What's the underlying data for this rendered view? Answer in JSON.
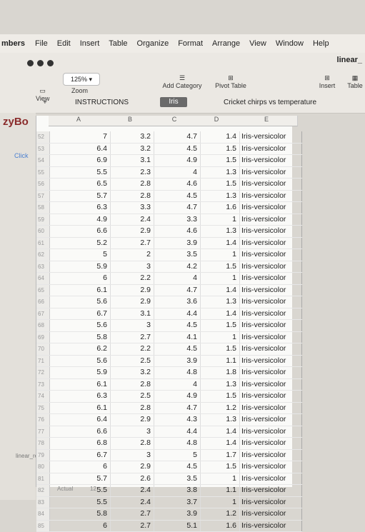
{
  "menubar": {
    "app": "mbers",
    "items": [
      "File",
      "Edit",
      "Insert",
      "Table",
      "Organize",
      "Format",
      "Arrange",
      "View",
      "Window",
      "Help"
    ]
  },
  "toolbar": {
    "doc_title": "linear_",
    "view_label": "View",
    "zoom_label": "Zoom",
    "zoom_value": "125%",
    "add_category": "Add Category",
    "pivot_table": "Pivot Table",
    "insert_label": "Insert",
    "table_label": "Table"
  },
  "tabs": {
    "instructions": "INSTRUCTIONS",
    "iris": "Iris",
    "cricket": "Cricket chirps vs temperature"
  },
  "sidebar": {
    "brand": "zyBo",
    "click": "Click",
    "bottom": "linear_reg"
  },
  "sheet": {
    "col_headers": [
      "A",
      "B",
      "C",
      "D",
      "E"
    ],
    "rows": [
      {
        "rn": "52",
        "a": "7",
        "b": "3.2",
        "c": "4.7",
        "d": "1.4",
        "e": "Iris-versicolor"
      },
      {
        "rn": "53",
        "a": "6.4",
        "b": "3.2",
        "c": "4.5",
        "d": "1.5",
        "e": "Iris-versicolor"
      },
      {
        "rn": "54",
        "a": "6.9",
        "b": "3.1",
        "c": "4.9",
        "d": "1.5",
        "e": "Iris-versicolor"
      },
      {
        "rn": "55",
        "a": "5.5",
        "b": "2.3",
        "c": "4",
        "d": "1.3",
        "e": "Iris-versicolor"
      },
      {
        "rn": "56",
        "a": "6.5",
        "b": "2.8",
        "c": "4.6",
        "d": "1.5",
        "e": "Iris-versicolor"
      },
      {
        "rn": "57",
        "a": "5.7",
        "b": "2.8",
        "c": "4.5",
        "d": "1.3",
        "e": "Iris-versicolor"
      },
      {
        "rn": "58",
        "a": "6.3",
        "b": "3.3",
        "c": "4.7",
        "d": "1.6",
        "e": "Iris-versicolor"
      },
      {
        "rn": "59",
        "a": "4.9",
        "b": "2.4",
        "c": "3.3",
        "d": "1",
        "e": "Iris-versicolor"
      },
      {
        "rn": "60",
        "a": "6.6",
        "b": "2.9",
        "c": "4.6",
        "d": "1.3",
        "e": "Iris-versicolor"
      },
      {
        "rn": "61",
        "a": "5.2",
        "b": "2.7",
        "c": "3.9",
        "d": "1.4",
        "e": "Iris-versicolor"
      },
      {
        "rn": "62",
        "a": "5",
        "b": "2",
        "c": "3.5",
        "d": "1",
        "e": "Iris-versicolor"
      },
      {
        "rn": "63",
        "a": "5.9",
        "b": "3",
        "c": "4.2",
        "d": "1.5",
        "e": "Iris-versicolor"
      },
      {
        "rn": "64",
        "a": "6",
        "b": "2.2",
        "c": "4",
        "d": "1",
        "e": "Iris-versicolor"
      },
      {
        "rn": "65",
        "a": "6.1",
        "b": "2.9",
        "c": "4.7",
        "d": "1.4",
        "e": "Iris-versicolor"
      },
      {
        "rn": "66",
        "a": "5.6",
        "b": "2.9",
        "c": "3.6",
        "d": "1.3",
        "e": "Iris-versicolor"
      },
      {
        "rn": "67",
        "a": "6.7",
        "b": "3.1",
        "c": "4.4",
        "d": "1.4",
        "e": "Iris-versicolor"
      },
      {
        "rn": "68",
        "a": "5.6",
        "b": "3",
        "c": "4.5",
        "d": "1.5",
        "e": "Iris-versicolor"
      },
      {
        "rn": "69",
        "a": "5.8",
        "b": "2.7",
        "c": "4.1",
        "d": "1",
        "e": "Iris-versicolor"
      },
      {
        "rn": "70",
        "a": "6.2",
        "b": "2.2",
        "c": "4.5",
        "d": "1.5",
        "e": "Iris-versicolor"
      },
      {
        "rn": "71",
        "a": "5.6",
        "b": "2.5",
        "c": "3.9",
        "d": "1.1",
        "e": "Iris-versicolor"
      },
      {
        "rn": "72",
        "a": "5.9",
        "b": "3.2",
        "c": "4.8",
        "d": "1.8",
        "e": "Iris-versicolor"
      },
      {
        "rn": "73",
        "a": "6.1",
        "b": "2.8",
        "c": "4",
        "d": "1.3",
        "e": "Iris-versicolor"
      },
      {
        "rn": "74",
        "a": "6.3",
        "b": "2.5",
        "c": "4.9",
        "d": "1.5",
        "e": "Iris-versicolor"
      },
      {
        "rn": "75",
        "a": "6.1",
        "b": "2.8",
        "c": "4.7",
        "d": "1.2",
        "e": "Iris-versicolor"
      },
      {
        "rn": "76",
        "a": "6.4",
        "b": "2.9",
        "c": "4.3",
        "d": "1.3",
        "e": "Iris-versicolor"
      },
      {
        "rn": "77",
        "a": "6.6",
        "b": "3",
        "c": "4.4",
        "d": "1.4",
        "e": "Iris-versicolor"
      },
      {
        "rn": "78",
        "a": "6.8",
        "b": "2.8",
        "c": "4.8",
        "d": "1.4",
        "e": "Iris-versicolor"
      },
      {
        "rn": "79",
        "a": "6.7",
        "b": "3",
        "c": "5",
        "d": "1.7",
        "e": "Iris-versicolor"
      },
      {
        "rn": "80",
        "a": "6",
        "b": "2.9",
        "c": "4.5",
        "d": "1.5",
        "e": "Iris-versicolor"
      },
      {
        "rn": "81",
        "a": "5.7",
        "b": "2.6",
        "c": "3.5",
        "d": "1",
        "e": "Iris-versicolor"
      },
      {
        "rn": "82",
        "a": "5.5",
        "b": "2.4",
        "c": "3.8",
        "d": "1.1",
        "e": "Iris-versicolor"
      },
      {
        "rn": "83",
        "a": "5.5",
        "b": "2.4",
        "c": "3.7",
        "d": "1",
        "e": "Iris-versicolor"
      },
      {
        "rn": "84",
        "a": "5.8",
        "b": "2.7",
        "c": "3.9",
        "d": "1.2",
        "e": "Iris-versicolor"
      },
      {
        "rn": "85",
        "a": "6",
        "b": "2.7",
        "c": "5.1",
        "d": "1.6",
        "e": "Iris-versicolor"
      }
    ]
  },
  "footer": {
    "actual": "Actual",
    "value": "12"
  }
}
